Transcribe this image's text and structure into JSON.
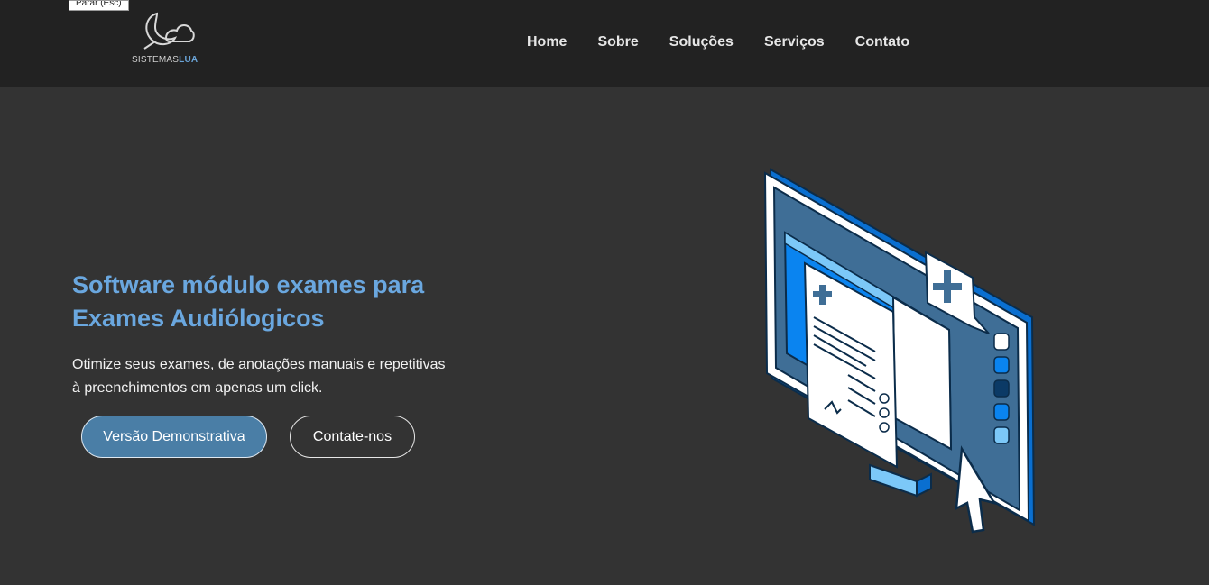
{
  "tooltip": {
    "text": "Parar (Esc)"
  },
  "brand": {
    "name_part1": "SISTEMAS",
    "name_part2": "LUA"
  },
  "nav": {
    "items": [
      {
        "label": "Home"
      },
      {
        "label": "Sobre"
      },
      {
        "label": "Soluções"
      },
      {
        "label": "Serviços"
      },
      {
        "label": "Contato"
      }
    ]
  },
  "hero": {
    "title_line1": "Software módulo exames para",
    "title_line2": "Exames Audiólogicos",
    "text_line1": "Otimize seus exames, de anotações manuais e repetitivas",
    "text_line2": "à preenchimentos em apenas um click.",
    "primary_button": "Versão Demonstrativa",
    "secondary_button": "Contate-nos"
  },
  "colors": {
    "background": "#333333",
    "header": "#222222",
    "accent": "#6aa7df",
    "button_primary": "#4a7ea6",
    "illustration_blue": "#0a84f0"
  },
  "icons": [
    "moon-cloud-logo-icon",
    "medical-cross-icon",
    "mouse-cursor-icon",
    "monitor-illustration"
  ]
}
